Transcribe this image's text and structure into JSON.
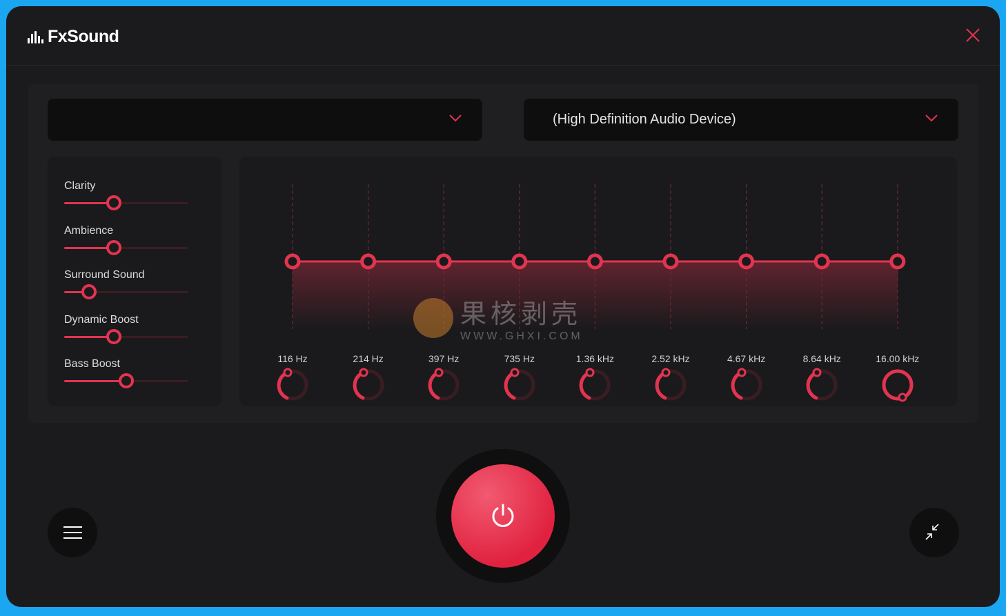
{
  "app": {
    "title": "FxSound"
  },
  "devices": {
    "preset_value": "",
    "output_value": "(High Definition Audio Device)"
  },
  "effects": [
    {
      "label": "Clarity",
      "value": 0.4
    },
    {
      "label": "Ambience",
      "value": 0.4
    },
    {
      "label": "Surround Sound",
      "value": 0.2
    },
    {
      "label": "Dynamic Boost",
      "value": 0.4
    },
    {
      "label": "Bass Boost",
      "value": 0.5
    }
  ],
  "eq": {
    "bands": [
      {
        "label": "116 Hz",
        "gain": 0
      },
      {
        "label": "214 Hz",
        "gain": 0
      },
      {
        "label": "397 Hz",
        "gain": 0
      },
      {
        "label": "735 Hz",
        "gain": 0
      },
      {
        "label": "1.36 kHz",
        "gain": 0
      },
      {
        "label": "2.52 kHz",
        "gain": 0
      },
      {
        "label": "4.67 kHz",
        "gain": 0
      },
      {
        "label": "8.64 kHz",
        "gain": 0
      },
      {
        "label": "16.00 kHz",
        "gain": 0
      }
    ]
  },
  "watermark": {
    "cn": "果核剥壳",
    "en": "WWW.GHXI.COM"
  },
  "colors": {
    "accent": "#e23450",
    "background": "#1b1b1d",
    "frame": "#1aa6f0"
  },
  "icons": {
    "close": "close-icon",
    "chevron": "chevron-down-icon",
    "power": "power-icon",
    "menu": "hamburger-menu-icon",
    "minimize": "minimize-arrows-icon"
  }
}
